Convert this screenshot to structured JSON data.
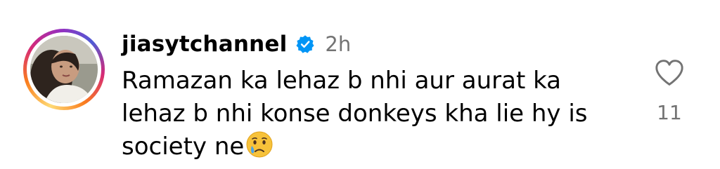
{
  "comment": {
    "username": "jiasytchannel",
    "timestamp": "2h",
    "text": "Ramazan ka lehaz b nhi aur aurat ka lehaz b nhi konse donkeys kha lie hy is society ne",
    "emoji": "crying-face",
    "verified": true
  },
  "likes": {
    "count": "11",
    "icon": "heart-outline-icon"
  },
  "colors": {
    "verified_blue": "#0095f6",
    "secondary_text": "#737373"
  }
}
